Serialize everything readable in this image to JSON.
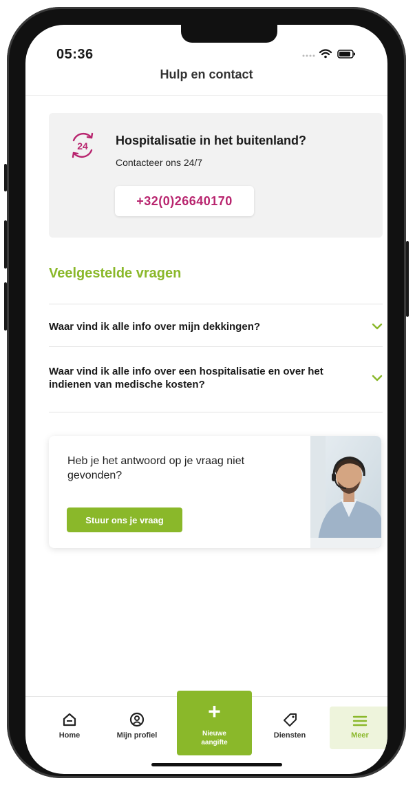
{
  "status_bar": {
    "time": "05:36"
  },
  "header": {
    "title": "Hulp en contact"
  },
  "emergency": {
    "title": "Hospitalisatie in het buitenland?",
    "subtitle": "Contacteer ons 24/7",
    "icon_label": "24",
    "phone": "+32(0)26640170",
    "accent": "#b8246e"
  },
  "faq": {
    "heading": "Veelgestelde vragen",
    "items": [
      {
        "question": "Waar vind ik alle info over mijn dekkingen?"
      },
      {
        "question": "Waar vind ik alle info over een hospitalisatie en over het indienen van medische kosten?"
      }
    ]
  },
  "contact_card": {
    "text": "Heb je het antwoord op je vraag niet gevonden?",
    "button_label": "Stuur ons je vraag"
  },
  "bottom_nav": {
    "home": "Home",
    "profile": "Mijn profiel",
    "new_line1": "Nieuwe",
    "new_line2": "aangifte",
    "services": "Diensten",
    "more": "Meer"
  },
  "colors": {
    "brand_green": "#8ab82a",
    "brand_magenta": "#b8246e"
  }
}
